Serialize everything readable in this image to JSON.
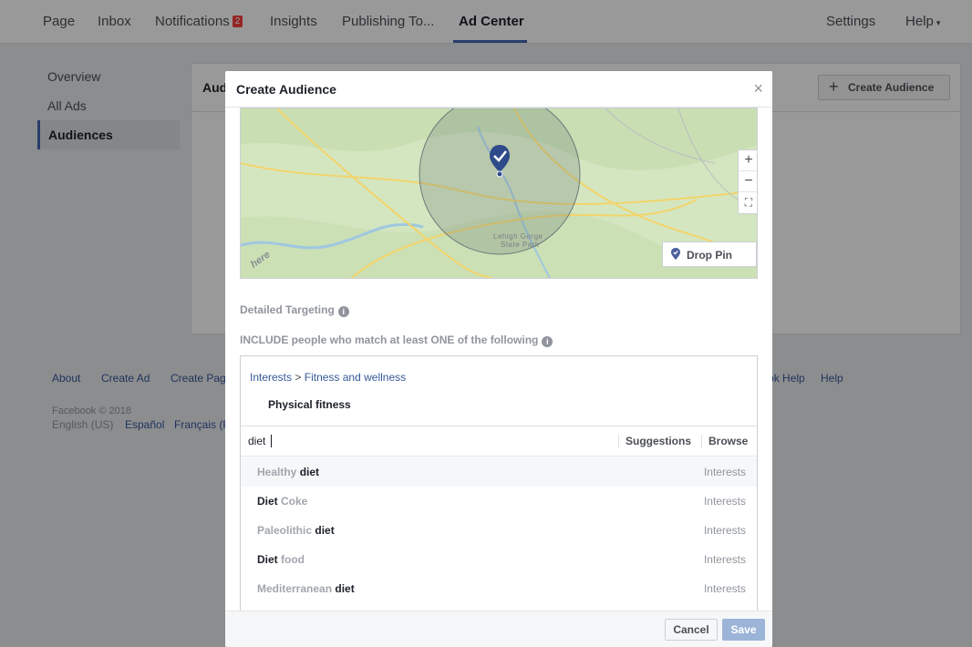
{
  "topnav": {
    "tabs": [
      "Page",
      "Inbox",
      "Notifications",
      "Insights",
      "Publishing To...",
      "Ad Center"
    ],
    "notifications_badge": "2",
    "settings": "Settings",
    "help": "Help",
    "help_caret": "▾"
  },
  "sidebar": {
    "items": [
      "Overview",
      "All Ads",
      "Audiences"
    ]
  },
  "main": {
    "title": "Audiences",
    "create_audience": "Create Audience",
    "plus": "+"
  },
  "footer": {
    "links": [
      "About",
      "Create Ad",
      "Create Page"
    ],
    "right_links": [
      "Facebook Help",
      "Help"
    ],
    "copyright": "Facebook © 2018",
    "lang_current": "English (US)",
    "lang_links": [
      "Español",
      "Français (France)"
    ]
  },
  "modal": {
    "title": "Create Audience",
    "close": "×",
    "map": {
      "zoom_in": "+",
      "zoom_out": "−",
      "fit": "⛶",
      "drop_pin": "Drop Pin",
      "place_label_1": "Lehigh Gorge",
      "place_label_2": "State Park",
      "watermark": "here"
    },
    "detailed_targeting": "Detailed Targeting",
    "include_label": "INCLUDE people who match at least ONE of the following",
    "info": "i",
    "breadcrumb": {
      "category": "Interests",
      "separator": ">",
      "subcategory": "Fitness and wellness"
    },
    "selected_interest": "Physical fitness",
    "search": {
      "value": "diet",
      "suggestions_tab": "Suggestions",
      "browse_tab": "Browse"
    },
    "suggestions": [
      {
        "pre": "Healthy ",
        "match": "diet",
        "post": "",
        "type": "Interests"
      },
      {
        "pre": "",
        "match": "Diet",
        "post": " Coke",
        "type": "Interests"
      },
      {
        "pre": "Paleolithic ",
        "match": "diet",
        "post": "",
        "type": "Interests"
      },
      {
        "pre": "",
        "match": "Diet",
        "post": " food",
        "type": "Interests"
      },
      {
        "pre": "Mediterranean ",
        "match": "diet",
        "post": "",
        "type": "Interests"
      }
    ],
    "cancel": "Cancel",
    "save": "Save"
  },
  "colors": {
    "brand": "#4267b2",
    "link": "#365899",
    "badge": "#fa3e3e",
    "save_disabled": "#9cb4d8"
  }
}
